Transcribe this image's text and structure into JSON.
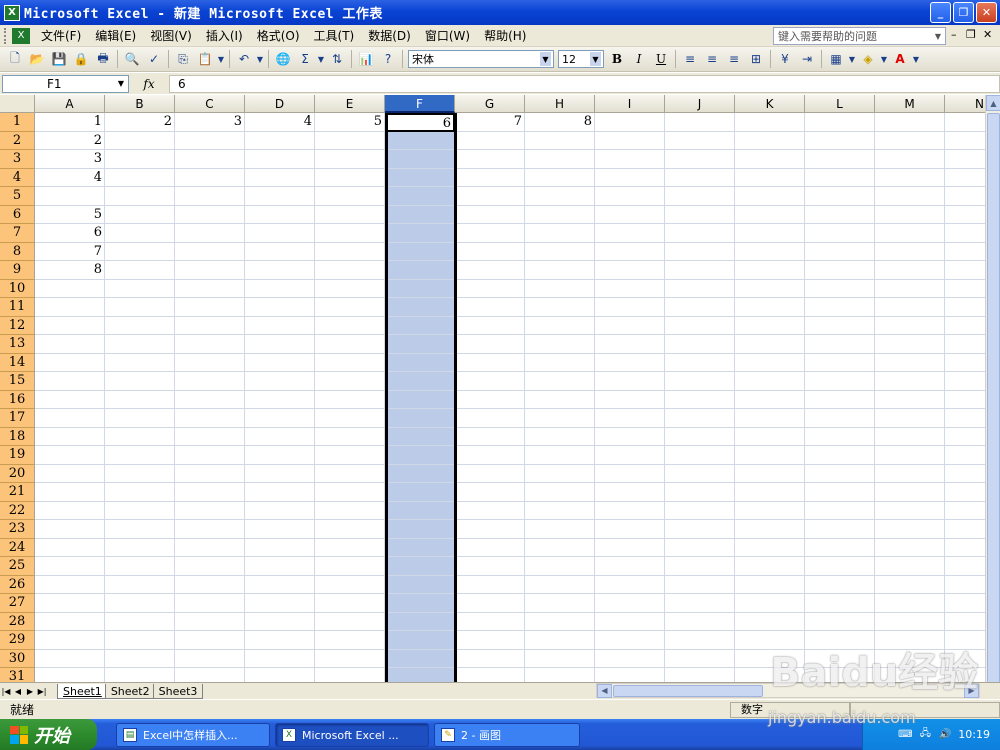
{
  "window": {
    "title": "Microsoft Excel - 新建 Microsoft Excel 工作表",
    "app_icon": "excel-icon"
  },
  "menu": [
    "文件(F)",
    "编辑(E)",
    "视图(V)",
    "插入(I)",
    "格式(O)",
    "工具(T)",
    "数据(D)",
    "窗口(W)",
    "帮助(H)"
  ],
  "help_box": {
    "placeholder": "键入需要帮助的问题"
  },
  "toolbar": {
    "font": "宋体",
    "size": "12",
    "bold": "B",
    "italic": "I",
    "underline": "U"
  },
  "formula_bar": {
    "name_box": "F1",
    "fx": "fx",
    "value": "6"
  },
  "columns": [
    "A",
    "B",
    "C",
    "D",
    "E",
    "F",
    "G",
    "H",
    "I",
    "J",
    "K",
    "L",
    "M",
    "N"
  ],
  "selected_column": "F",
  "active_cell": "F1",
  "rows": [
    "1",
    "2",
    "3",
    "4",
    "5",
    "6",
    "7",
    "8",
    "9",
    "10",
    "11",
    "12",
    "13",
    "14",
    "15",
    "16",
    "17",
    "18",
    "19",
    "20",
    "21",
    "22",
    "23",
    "24",
    "25",
    "26",
    "27",
    "28",
    "29",
    "30",
    "31"
  ],
  "cells": {
    "A1": "1",
    "B1": "2",
    "C1": "3",
    "D1": "4",
    "E1": "5",
    "F1": "6",
    "G1": "7",
    "H1": "8",
    "A2": "2",
    "A3": "3",
    "A4": "4",
    "A6": "5",
    "A7": "6",
    "A8": "7",
    "A9": "8"
  },
  "sheet_tabs": [
    "Sheet1",
    "Sheet2",
    "Sheet3"
  ],
  "active_sheet": "Sheet1",
  "status": {
    "left": "就绪",
    "mode": "数字"
  },
  "taskbar": {
    "start": "开始",
    "tasks": [
      "Excel中怎样插入...",
      "Microsoft Excel ...",
      "2 - 画图"
    ],
    "active_task": 1,
    "clock": "10:19"
  },
  "watermark": {
    "logo": "Baidu经验",
    "url": "jingyan.baidu.com"
  }
}
